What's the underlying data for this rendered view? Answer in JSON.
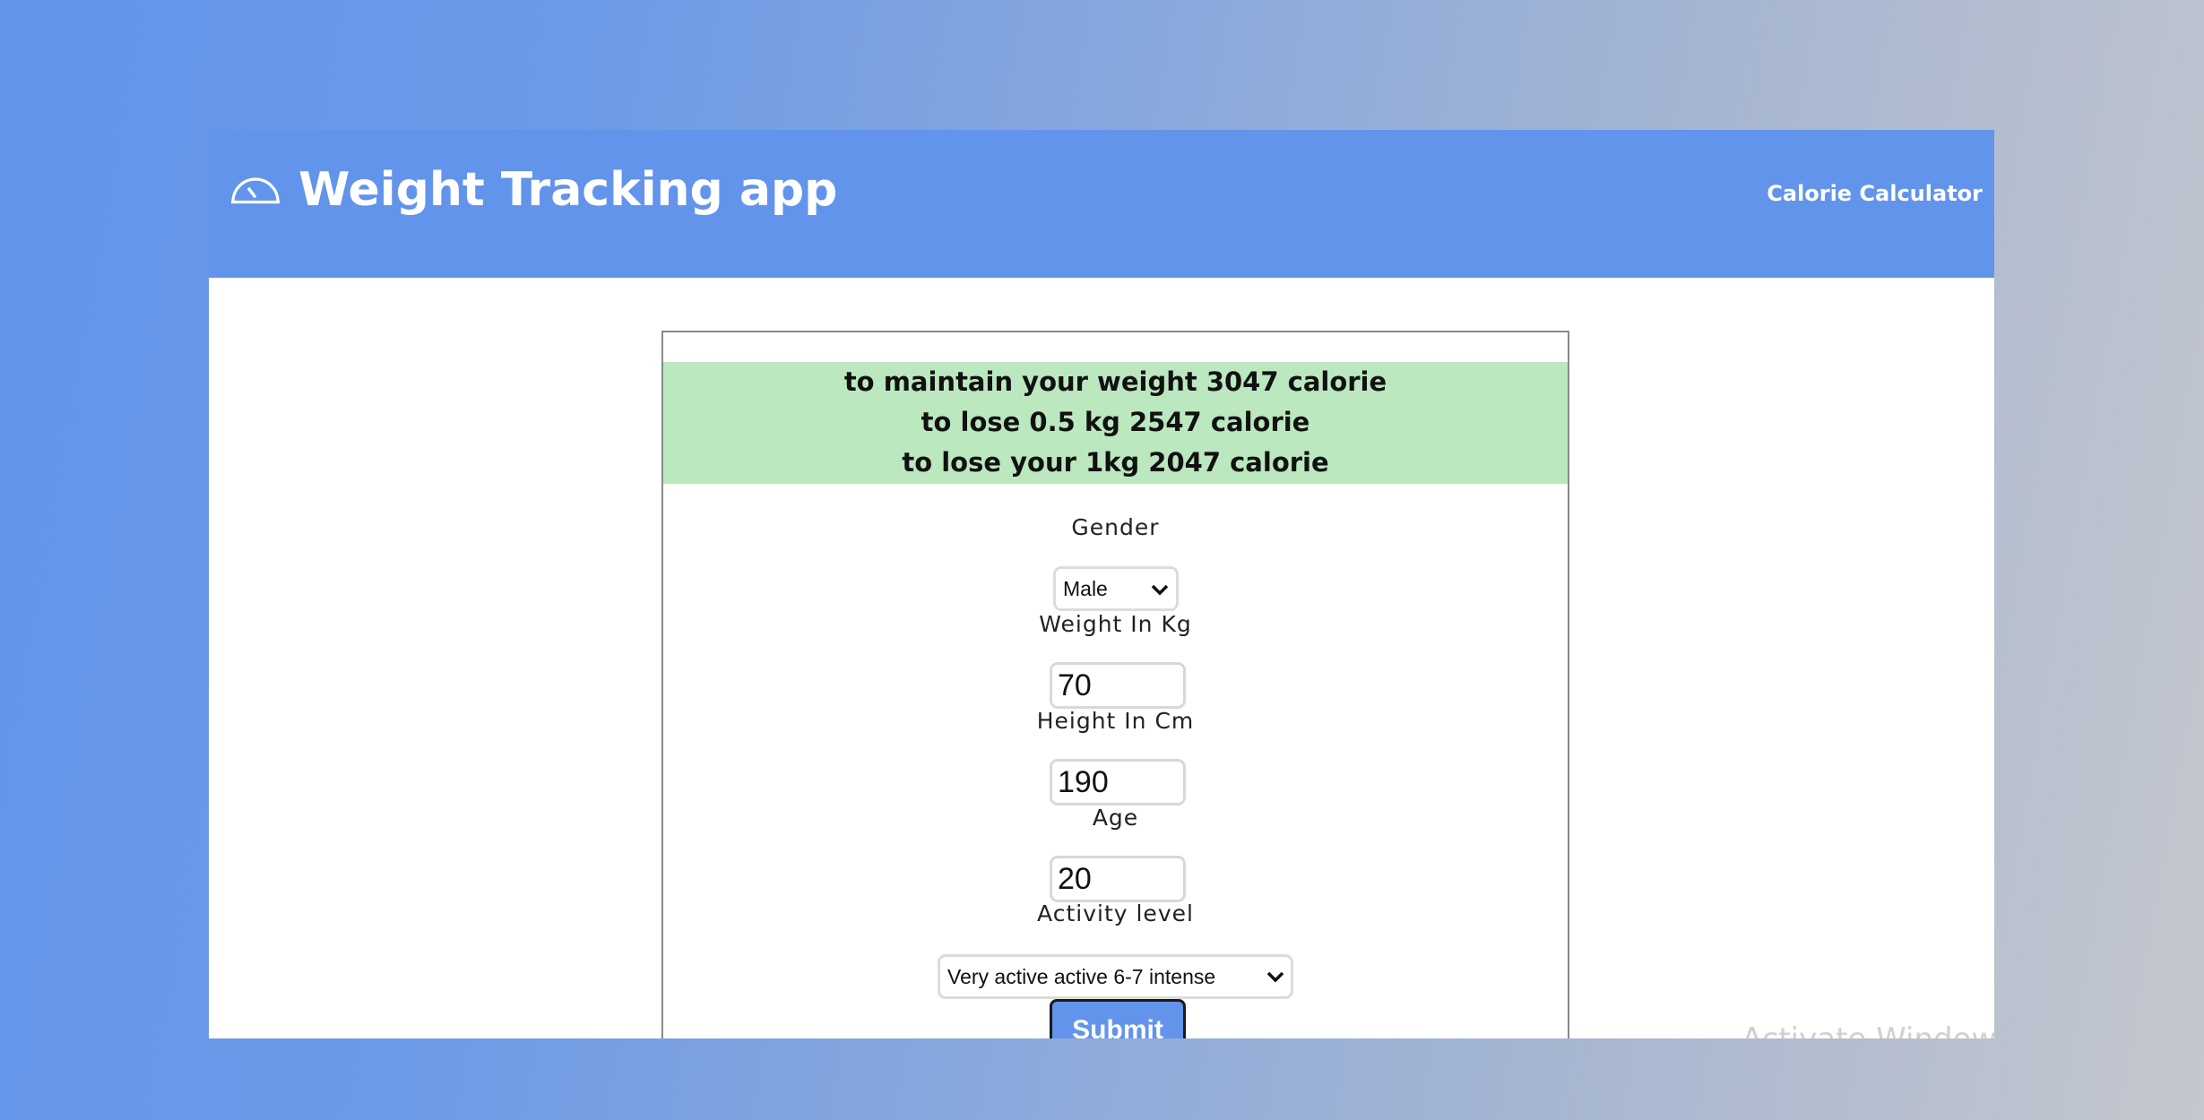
{
  "app": {
    "title": "Weight Tracking app",
    "brand_icon": "gauge-icon"
  },
  "nav": {
    "calorie_calculator": "Calorie Calculator"
  },
  "results": {
    "maintain": "to maintain your weight 3047 calorie",
    "lose_half": "to lose 0.5 kg 2547 calorie",
    "lose_one": "to lose your 1kg 2047 calorie"
  },
  "form": {
    "gender_label": "Gender",
    "gender_value": "Male",
    "weight_label": "Weight In Kg",
    "weight_value": "70",
    "height_label": "Height In Cm",
    "height_value": "190",
    "age_label": "Age",
    "age_value": "20",
    "activity_label": "Activity level",
    "activity_value": "Very active active 6-7 intense",
    "submit_label": "Submit"
  },
  "overlay": {
    "watermark": "Activate Windows"
  },
  "colors": {
    "navbar": "#6394eb",
    "result_bg": "#bbe8bf",
    "button": "#6394eb"
  }
}
